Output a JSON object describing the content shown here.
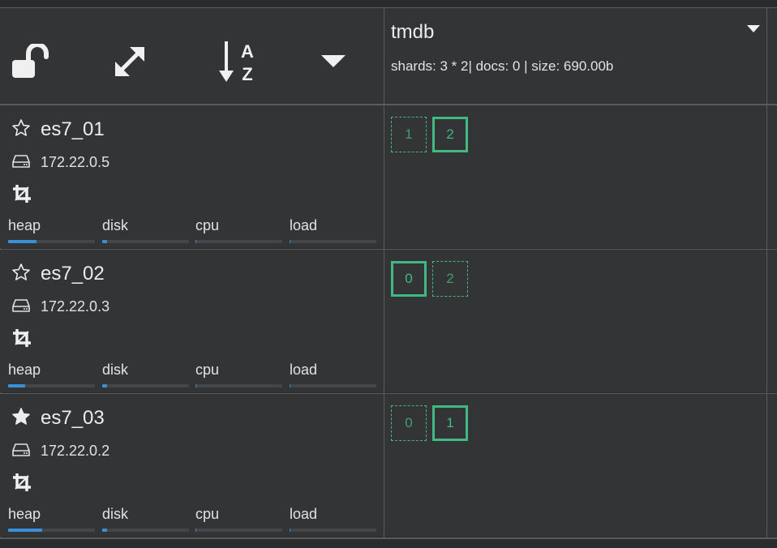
{
  "toolbar": {
    "icons": [
      "unlock-icon",
      "expand-icon",
      "sort-alpha-icon",
      "caret-down-icon"
    ]
  },
  "index": {
    "name": "tmdb",
    "stats": "shards: 3 * 2| docs: 0 | size: 690.00b"
  },
  "nodes": [
    {
      "name": "es7_01",
      "ip": "172.22.0.5",
      "master": false,
      "metrics": {
        "labels": [
          "heap",
          "disk",
          "cpu",
          "load"
        ],
        "values": [
          0.33,
          0.06,
          0.01,
          0.01
        ]
      },
      "shards": [
        {
          "label": "1",
          "primary": false
        },
        {
          "label": "2",
          "primary": true
        }
      ]
    },
    {
      "name": "es7_02",
      "ip": "172.22.0.3",
      "master": false,
      "metrics": {
        "labels": [
          "heap",
          "disk",
          "cpu",
          "load"
        ],
        "values": [
          0.2,
          0.06,
          0.01,
          0.01
        ]
      },
      "shards": [
        {
          "label": "0",
          "primary": true
        },
        {
          "label": "2",
          "primary": false
        }
      ]
    },
    {
      "name": "es7_03",
      "ip": "172.22.0.2",
      "master": true,
      "metrics": {
        "labels": [
          "heap",
          "disk",
          "cpu",
          "load"
        ],
        "values": [
          0.39,
          0.06,
          0.01,
          0.01
        ]
      },
      "shards": [
        {
          "label": "0",
          "primary": false
        },
        {
          "label": "1",
          "primary": true
        }
      ]
    }
  ],
  "colors": {
    "background": "#2a2b2d",
    "cell": "#333436",
    "grid": "#5a5b5d",
    "shard": "#42b883",
    "bar_fill": "#3b8fd6",
    "bar_track": "#44464a"
  }
}
